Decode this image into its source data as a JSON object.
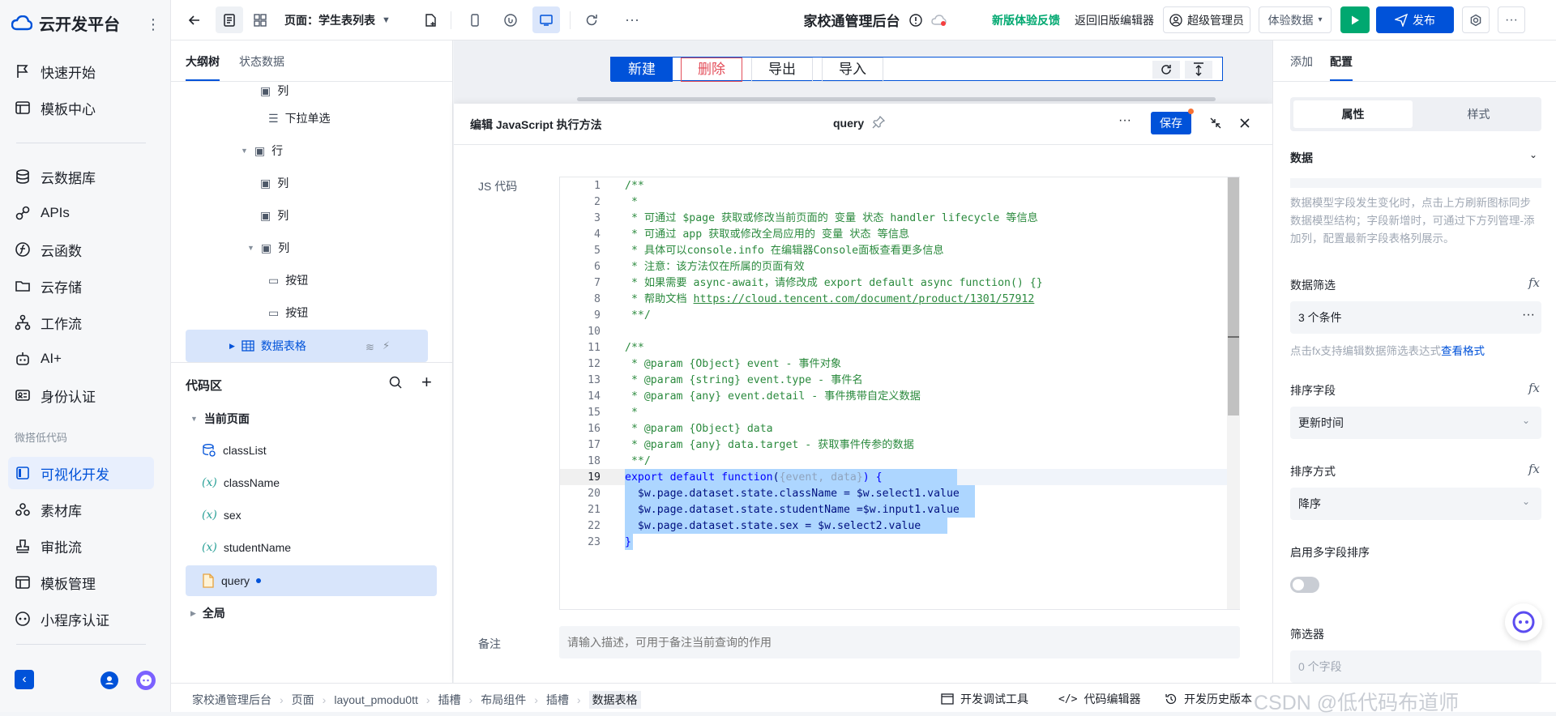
{
  "leftnav": {
    "brand": "云开发平台",
    "items": [
      "快速开始",
      "模板中心",
      "云数据库",
      "APIs",
      "云函数",
      "云存储",
      "工作流",
      "AI+",
      "身份认证"
    ],
    "section_label": "微搭低代码",
    "low_code_items": [
      "可视化开发",
      "素材库",
      "审批流",
      "模板管理",
      "小程序认证"
    ],
    "active": "可视化开发"
  },
  "topbar": {
    "page_label": "页面：学生表列表",
    "app_title": "家校通管理后台",
    "feedback": "新版体验反馈",
    "back_old": "返回旧版编辑器",
    "admin": "超级管理员",
    "data_select": "体验数据",
    "publish": "发布"
  },
  "outline": {
    "tabs": [
      "大纲树",
      "状态数据"
    ],
    "tree": [
      {
        "label": "列"
      },
      {
        "label": "下拉单选"
      },
      {
        "label": "行"
      },
      {
        "label": "列"
      },
      {
        "label": "列"
      },
      {
        "label": "列"
      },
      {
        "label": "按钮"
      },
      {
        "label": "按钮"
      },
      {
        "label": "数据表格"
      }
    ],
    "code_section_title": "代码区",
    "current_page": "当前页面",
    "code_items": [
      "classList",
      "className",
      "sex",
      "studentName",
      "query"
    ],
    "global": "全局"
  },
  "canvas": {
    "buttons": [
      "新建",
      "删除",
      "导出",
      "导入"
    ]
  },
  "editor": {
    "title": "编辑 JavaScript 执行方法",
    "method_name": "query",
    "save": "保存",
    "js_label": "JS 代码",
    "remark_label": "备注",
    "remark_placeholder": "请输入描述，可用于备注当前查询的作用",
    "code_lines": [
      "/**",
      " *",
      " * 可通过 $page 获取或修改当前页面的 变量 状态 handler lifecycle 等信息",
      " * 可通过 app 获取或修改全局应用的 变量 状态 等信息",
      " * 具体可以console.info 在编辑器Console面板查看更多信息",
      " * 注意：该方法仅在所属的页面有效",
      " * 如果需要 async-await，请修改成 export default async function() {}",
      " * 帮助文档 https://cloud.tencent.com/document/product/1301/57912",
      " **/",
      "",
      "/**",
      " * @param {Object} event - 事件对象",
      " * @param {string} event.type - 事件名",
      " * @param {any} event.detail - 事件携带自定义数据",
      " *",
      " * @param {Object} data",
      " * @param {any} data.target - 获取事件传参的数据",
      " **/",
      "export default function({event, data}) {",
      "  $w.page.dataset.state.className = $w.select1.value",
      "  $w.page.dataset.state.studentName =$w.input1.value",
      "  $w.page.dataset.state.sex = $w.select2.value",
      "}"
    ]
  },
  "rightpanel": {
    "tabs": [
      "添加",
      "配置"
    ],
    "subtabs": [
      "属性",
      "样式"
    ],
    "data_section": "数据",
    "data_hint": "数据模型字段发生变化时，点击上方刷新图标同步数据模型结构；字段新增时，可通过下方列管理-添加列，配置最新字段表格列展示。",
    "filter_label": "数据筛选",
    "filter_value": "3 个条件",
    "filter_hint": "点击fx支持编辑数据筛选表达式",
    "filter_link": "查看格式",
    "sort_field_label": "排序字段",
    "sort_field_value": "更新时间",
    "sort_order_label": "排序方式",
    "sort_order_value": "降序",
    "multi_sort_label": "启用多字段排序",
    "filterer_label": "筛选器",
    "filterer_value": "0 个字段"
  },
  "statusbar": {
    "breadcrumb": [
      "家校通管理后台",
      "页面",
      "layout_pmodu0tt",
      "插槽",
      "布局组件",
      "插槽",
      "数据表格"
    ],
    "tools": [
      "开发调试工具",
      "代码编辑器",
      "开发历史版本"
    ]
  },
  "watermark": "CSDN @低代码布道师"
}
